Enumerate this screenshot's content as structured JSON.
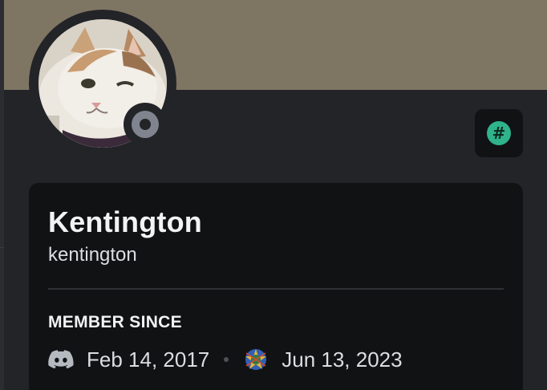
{
  "profile": {
    "display_name": "Kentington",
    "username": "kentington",
    "status": "offline",
    "colors": {
      "banner": "#7f7563",
      "card": "#111214",
      "background": "#232428",
      "badge": "#2fb38a"
    }
  },
  "badge": {
    "icon": "hashtag-icon",
    "glyph": "#"
  },
  "member_since": {
    "title": "MEMBER SINCE",
    "discord_icon": "discord-icon",
    "discord_date": "Feb 14, 2017",
    "server_icon": "server-icon",
    "server_date": "Jun 13, 2023"
  }
}
